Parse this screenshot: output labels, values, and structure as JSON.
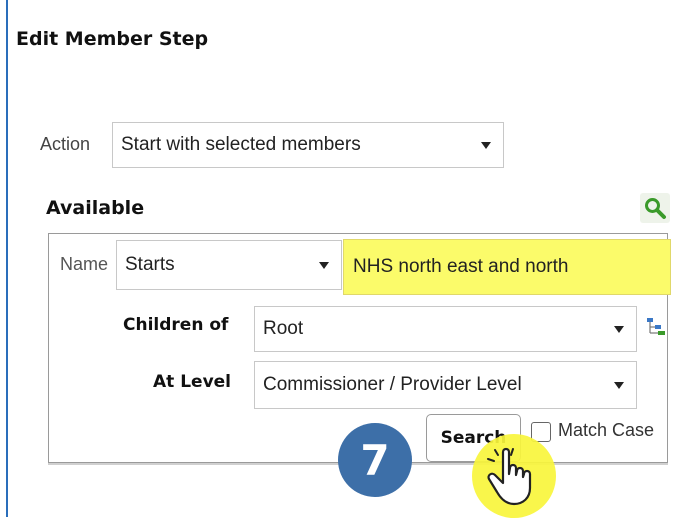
{
  "dialog": {
    "title": "Edit Member Step"
  },
  "action": {
    "label": "Action",
    "selected": "Start with selected members"
  },
  "available": {
    "heading": "Available",
    "name_label": "Name",
    "name_operator": "Starts",
    "name_value": "NHS north east and north",
    "children_of_label": "Children of",
    "children_of_value": "Root",
    "at_level_label": "At Level",
    "at_level_value": "Commissioner / Provider Level",
    "search_button": "Search",
    "match_case_label": "Match Case",
    "match_case_checked": false
  },
  "annotation": {
    "step_number": "7",
    "badge_color": "#3d6fa8",
    "highlight_color": "#fbfb6a"
  },
  "icons": [
    "search-icon",
    "hierarchy-icon",
    "pointer-hand-icon"
  ]
}
